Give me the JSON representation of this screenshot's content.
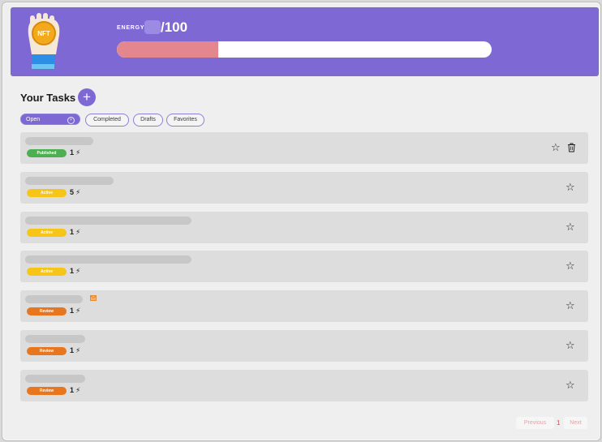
{
  "header": {
    "energy_label": "ENERGY",
    "energy_max": "/100",
    "energy_fraction": 0.27,
    "mascot_text": "NFT"
  },
  "tasks_section": {
    "title": "Your Tasks",
    "add_label": "+"
  },
  "filters": [
    {
      "label": "Open",
      "active": true
    },
    {
      "label": "Completed",
      "active": false
    },
    {
      "label": "Drafts",
      "active": false
    },
    {
      "label": "Favorites",
      "active": false
    }
  ],
  "tasks": [
    {
      "status": "Published",
      "count": "1",
      "color": "#4caf50",
      "skeleton_fraction": 0.27
    },
    {
      "status": "Active",
      "count": "5",
      "color": "#f7c418",
      "skeleton_fraction": 0.35
    },
    {
      "status": "Active",
      "count": "1",
      "color": "#f7c418",
      "skeleton_fraction": 0.66
    },
    {
      "status": "Active",
      "count": "1",
      "color": "#f7c418",
      "skeleton_fraction": 0.66
    },
    {
      "status": "Review",
      "count": "1",
      "color": "#e8761f",
      "skeleton_fraction": 0.23
    },
    {
      "status": "Review",
      "count": "1",
      "color": "#e8761f",
      "skeleton_fraction": 0.24
    },
    {
      "status": "Review",
      "count": "1",
      "color": "#e8761f",
      "skeleton_fraction": 0.24
    }
  ],
  "icons": {
    "star": "star-icon",
    "trash": "trash-icon",
    "bolt": "lightning-icon",
    "mail": "mail-icon",
    "add": "plus-icon"
  },
  "pagination": {
    "previous": "Previous",
    "current": "1",
    "next": "Next"
  }
}
